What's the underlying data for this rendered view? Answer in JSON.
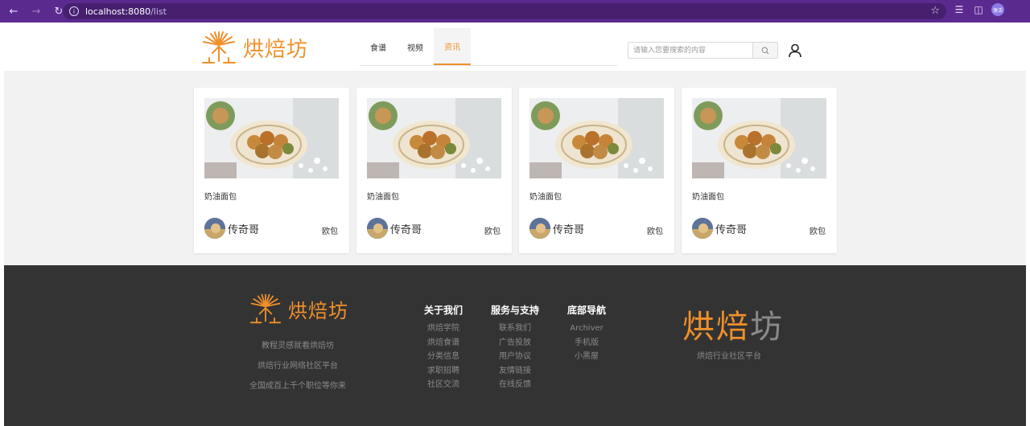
{
  "browser": {
    "url_host": "localhost:8080",
    "url_path": "/list",
    "profile_label": "激活"
  },
  "header": {
    "brand": "烘焙坊",
    "nav": [
      {
        "label": "食谱",
        "active": false
      },
      {
        "label": "视频",
        "active": false
      },
      {
        "label": "资讯",
        "active": true
      }
    ],
    "search_placeholder": "请输入您要搜索的内容"
  },
  "cards": [
    {
      "title": "奶油面包",
      "author": "传奇哥",
      "tag": "欧包"
    },
    {
      "title": "奶油面包",
      "author": "传奇哥",
      "tag": "欧包"
    },
    {
      "title": "奶油面包",
      "author": "传奇哥",
      "tag": "欧包"
    },
    {
      "title": "奶油面包",
      "author": "传奇哥",
      "tag": "欧包"
    }
  ],
  "footer": {
    "brand": "烘焙坊",
    "slogans": [
      "教程灵感就看烘焙坊",
      "烘焙行业网络社区平台",
      "全国成百上千个职位等你来"
    ],
    "columns": [
      {
        "title": "关于我们",
        "links": [
          "烘焙学院",
          "烘焙食谱",
          "分类信息",
          "求职招聘",
          "社区交流"
        ]
      },
      {
        "title": "服务与支持",
        "links": [
          "联系我们",
          "广告投放",
          "用户协议",
          "友情链接",
          "在线反馈"
        ]
      },
      {
        "title": "底部导航",
        "links": [
          "Archiver",
          "手机版",
          "小黑屋"
        ]
      }
    ],
    "big_brand_a": "烘焙",
    "big_brand_b": "坊",
    "big_sub": "烘焙行业社区平台"
  },
  "colors": {
    "accent": "#f0902a",
    "footer_bg": "#333333",
    "browser_bar": "#5b2a8f"
  }
}
